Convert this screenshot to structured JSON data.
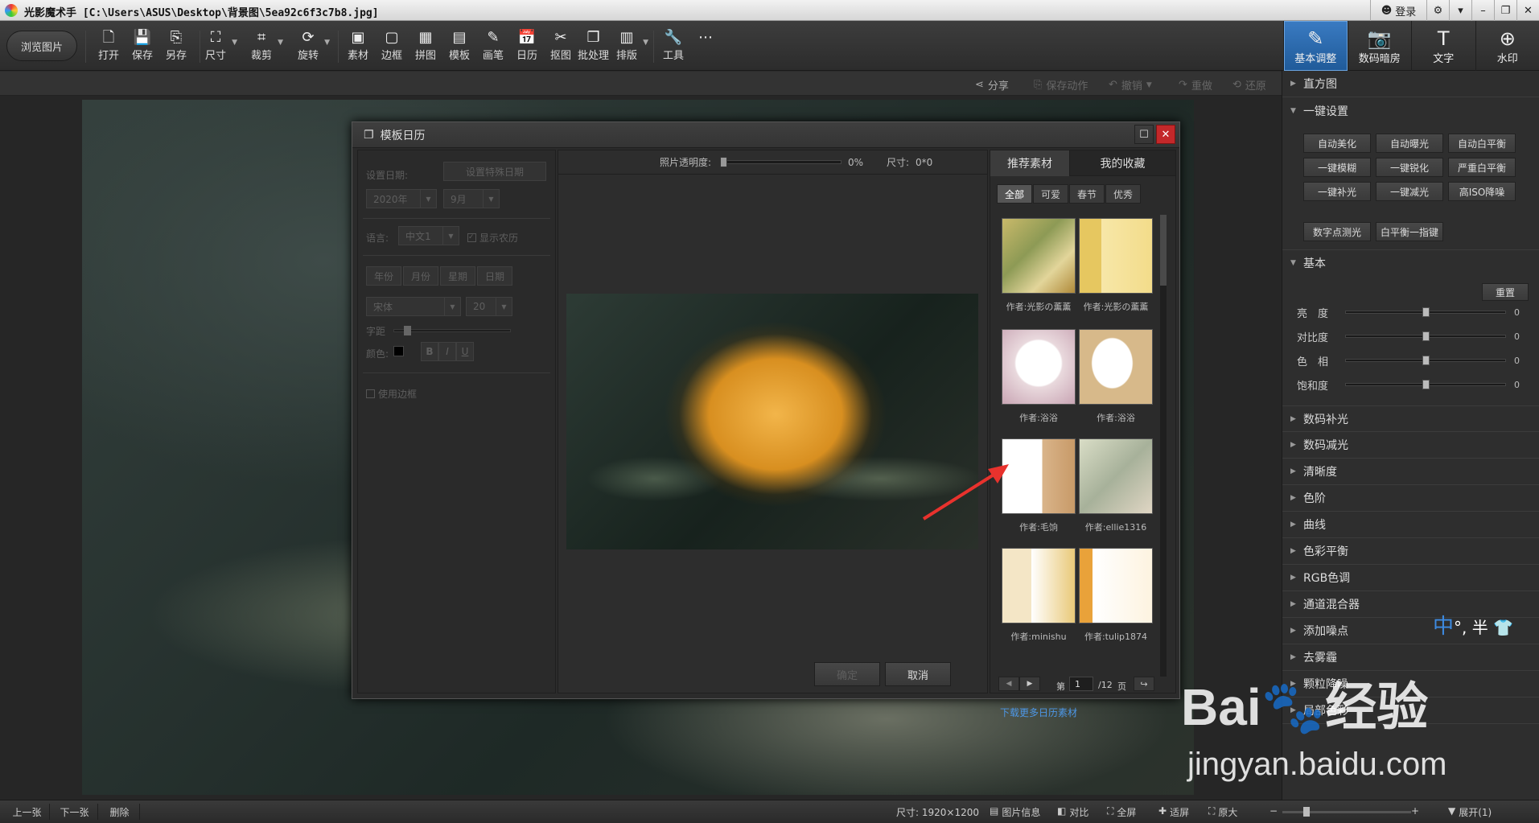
{
  "titlebar": {
    "title": "光影魔术手  [C:\\Users\\ASUS\\Desktop\\背景图\\5ea92c6f3c7b8.jpg]",
    "login": "登录",
    "ctrls": [
      "⚙",
      "▾",
      "–",
      "❐",
      "✕"
    ]
  },
  "toolbar": {
    "browse": "浏览图片",
    "tools": [
      {
        "icon": "🗋",
        "label": "打开"
      },
      {
        "icon": "💾",
        "label": "保存"
      },
      {
        "icon": "⎘",
        "label": "另存"
      },
      {
        "icon": "⛶",
        "label": "尺寸"
      },
      {
        "icon": "⌗",
        "label": "裁剪"
      },
      {
        "icon": "⟳",
        "label": "旋转"
      },
      {
        "icon": "▣",
        "label": "素材"
      },
      {
        "icon": "▢",
        "label": "边框"
      },
      {
        "icon": "▦",
        "label": "拼图"
      },
      {
        "icon": "▤",
        "label": "模板"
      },
      {
        "icon": "✎",
        "label": "画笔"
      },
      {
        "icon": "📅",
        "label": "日历"
      },
      {
        "icon": "✂",
        "label": "抠图"
      },
      {
        "icon": "❐",
        "label": "批处理"
      },
      {
        "icon": "▥",
        "label": "排版"
      },
      {
        "icon": "🔧",
        "label": "工具"
      },
      {
        "icon": "⋯",
        "label": ""
      }
    ]
  },
  "right_tabs": [
    {
      "icon": "✎",
      "label": "基本调整"
    },
    {
      "icon": "📷",
      "label": "数码暗房"
    },
    {
      "icon": "T",
      "label": "文字"
    },
    {
      "icon": "⊕",
      "label": "水印"
    }
  ],
  "subbar": {
    "share": "分享",
    "save_action": "保存动作",
    "undo": "撤销",
    "redo": "重做",
    "restore": "还原"
  },
  "panel": {
    "histogram": "直方图",
    "one_key": "一键设置",
    "quick": [
      "自动美化",
      "自动曝光",
      "自动白平衡",
      "一键模糊",
      "一键锐化",
      "严重白平衡",
      "一键补光",
      "一键减光",
      "高ISO降噪",
      "数字点测光",
      "白平衡一指键"
    ],
    "basic": "基本",
    "reset": "重置",
    "sliders": [
      {
        "label": "亮　度",
        "value": "0",
        "fraction": 0.5
      },
      {
        "label": "对比度",
        "value": "0",
        "fraction": 0.5
      },
      {
        "label": "色　相",
        "value": "0",
        "fraction": 0.5
      },
      {
        "label": "饱和度",
        "value": "0",
        "fraction": 0.5
      }
    ],
    "sections": [
      "数码补光",
      "数码减光",
      "清晰度",
      "色阶",
      "曲线",
      "色彩平衡",
      "RGB色调",
      "通道混合器",
      "添加噪点",
      "去雾霾",
      "颗粒降噪",
      "局部色彩"
    ]
  },
  "dialog": {
    "title": "模板日历",
    "set_date": "设置日期:",
    "special_date": "设置特殊日期",
    "year": "2020年",
    "month": "9月",
    "language_label": "语言:",
    "language": "中文1",
    "lunar": "显示农历",
    "tabs": [
      "年份",
      "月份",
      "星期",
      "日期"
    ],
    "font": "宋体",
    "size": "20",
    "spacing": "字距",
    "color": "颜色:",
    "styles": [
      "B",
      "I",
      "U"
    ],
    "border": "使用边框",
    "opacity_label": "照片透明度:",
    "opacity": "0%",
    "size_label": "尺寸:",
    "size_value": "0*0",
    "ok": "确定",
    "cancel": "取消",
    "mat_tabs": [
      "推荐素材",
      "我的收藏"
    ],
    "cats": [
      "全部",
      "可爱",
      "春节",
      "优秀"
    ],
    "authors": [
      "作者:光影の薰薰",
      "作者:光影の薰薰",
      "作者:浴浴",
      "作者:浴浴",
      "作者:毛饷",
      "作者:ellie1316",
      "作者:minishu",
      "作者:tulip1874"
    ],
    "page_prefix": "第",
    "page": "1",
    "page_total": "/12",
    "page_suffix": "页",
    "more": "下载更多日历素材"
  },
  "status": {
    "prev": "上一张",
    "next": "下一张",
    "delete": "删除",
    "size": "尺寸: 1920×1200",
    "info": "图片信息",
    "compare": "对比",
    "fullscreen": "全屏",
    "fit": "适屏",
    "original": "原大",
    "expand": "展开(1)"
  },
  "ime": {
    "cn": "中",
    "rest": "°, 半 👕"
  },
  "watermark": {
    "logo": "Bai🐾经验",
    "url": "jingyan.baidu.com"
  }
}
